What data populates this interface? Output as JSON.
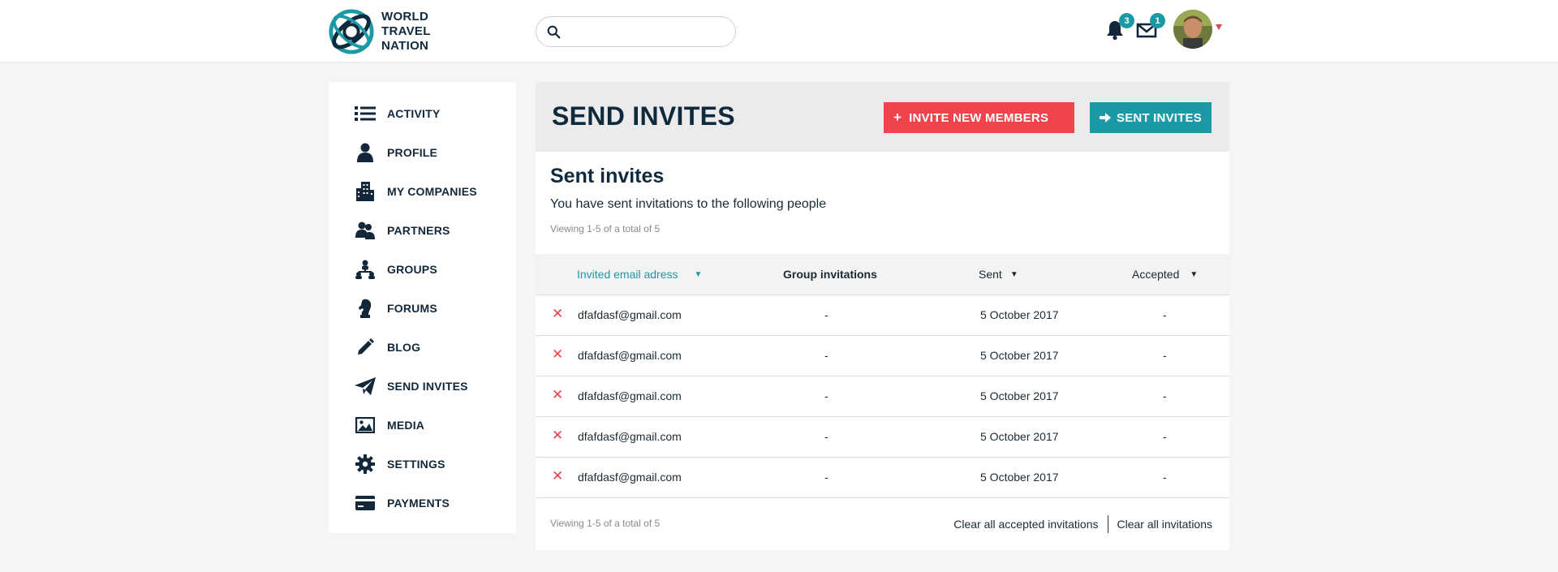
{
  "brand": {
    "line1": "WORLD",
    "line2": "TRAVEL",
    "line3": "NATION"
  },
  "search": {
    "placeholder": ""
  },
  "header": {
    "notifications_count": "3",
    "messages_count": "1"
  },
  "sidebar": {
    "items": [
      {
        "label": "ACTIVITY",
        "icon": "list-icon"
      },
      {
        "label": "PROFILE",
        "icon": "user-icon"
      },
      {
        "label": "MY COMPANIES",
        "icon": "building-icon"
      },
      {
        "label": "PARTNERS",
        "icon": "partners-icon"
      },
      {
        "label": "GROUPS",
        "icon": "groups-icon"
      },
      {
        "label": "FORUMS",
        "icon": "chess-knight-icon"
      },
      {
        "label": "BLOG",
        "icon": "pencil-icon"
      },
      {
        "label": "SEND INVITES",
        "icon": "paper-plane-icon"
      },
      {
        "label": "MEDIA",
        "icon": "image-icon"
      },
      {
        "label": "SETTINGS",
        "icon": "gear-icon"
      },
      {
        "label": "PAYMENTS",
        "icon": "credit-card-icon"
      }
    ]
  },
  "main": {
    "title": "SEND INVITES",
    "invite_button": "INVITE NEW MEMBERS",
    "sent_button": "SENT INVITES",
    "section_title": "Sent invites",
    "section_text": "You have sent invitations to the following people",
    "viewing": "Viewing 1-5 of a total of 5",
    "table": {
      "headers": {
        "email": "Invited email adress",
        "group": "Group invitations",
        "sent": "Sent",
        "accepted": "Accepted"
      },
      "rows": [
        {
          "email": "dfafdasf@gmail.com",
          "group": "-",
          "sent": "5 October 2017",
          "accepted": "-"
        },
        {
          "email": "dfafdasf@gmail.com",
          "group": "-",
          "sent": "5 October 2017",
          "accepted": "-"
        },
        {
          "email": "dfafdasf@gmail.com",
          "group": "-",
          "sent": "5 October 2017",
          "accepted": "-"
        },
        {
          "email": "dfafdasf@gmail.com",
          "group": "-",
          "sent": "5 October 2017",
          "accepted": "-"
        },
        {
          "email": "dfafdasf@gmail.com",
          "group": "-",
          "sent": "5 October 2017",
          "accepted": "-"
        }
      ]
    },
    "footer": {
      "viewing": "Viewing 1-5 of a total of 5",
      "clear_accepted": "Clear all accepted invitations",
      "clear_all": "Clear all invitations"
    }
  },
  "colors": {
    "brand_dark": "#0f2a3c",
    "accent_teal": "#1b9aa6",
    "accent_red": "#f0434b"
  }
}
